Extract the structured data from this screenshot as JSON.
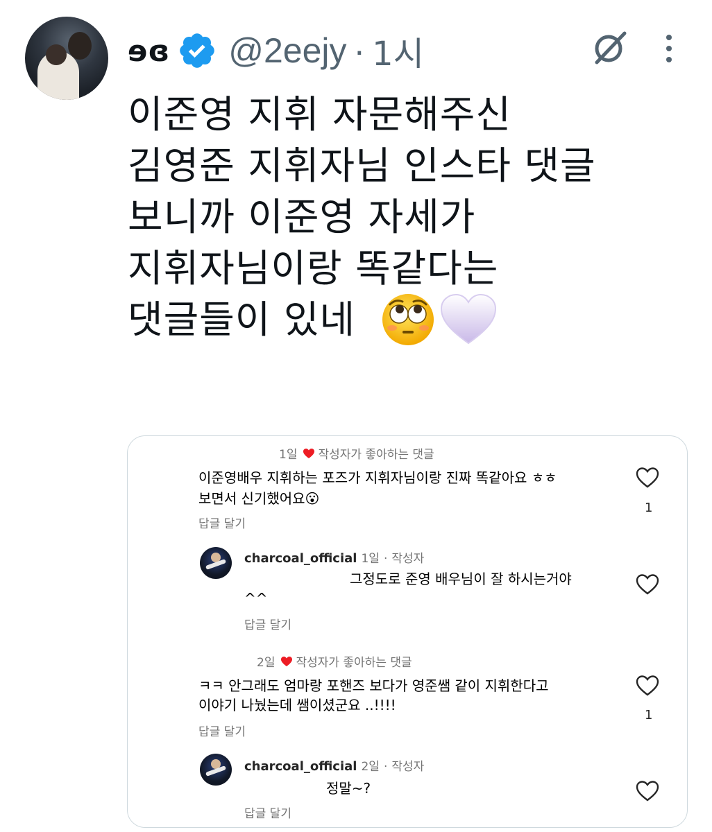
{
  "tweet": {
    "display_name": "ɘɞ",
    "handle": "@2eejy",
    "separator": "·",
    "time": "1시",
    "lines": [
      "이준영 지휘 자문해주신",
      "김영준 지휘자님 인스타 댓글",
      "보니까 이준영 자세가",
      "지휘자님이랑 똑같다는",
      "댓글들이 있네"
    ]
  },
  "embedded": {
    "comments": [
      {
        "date": "1일",
        "liked_label": "작성자가 좋아하는 댓글",
        "line1": "이준영배우 지휘하는 포즈가 지휘자님이랑 진짜 똑같아요 ㅎㅎ",
        "line2": "보면서 신기했어요😮",
        "reply_label": "답글 달기",
        "like_count": "1"
      },
      {
        "author": "charcoal_official",
        "date": "1일",
        "role": "작성자",
        "line1": "그정도로 준영 배우님이 잘 하시는거야",
        "line2": "^^",
        "reply_label": "답글 달기"
      },
      {
        "date": "2일",
        "liked_label": "작성자가 좋아하는 댓글",
        "line1": "ㅋㅋ 안그래도 엄마랑 포핸즈 보다가  영준쌤 같이 지휘한다고",
        "line2": "이야기 나눴는데 쌤이셨군요 ..!!!!",
        "reply_label": "답글 달기",
        "like_count": "1"
      },
      {
        "author": "charcoal_official",
        "date": "2일",
        "role": "작성자",
        "line1": "정말~?",
        "reply_label": "답글 달기"
      }
    ]
  },
  "icons": {
    "verified": "verified-badge-icon",
    "grok": "grok-icon",
    "more": "more-vertical-icon",
    "heart": "heart-outline-icon",
    "liked": "red-heart-icon"
  },
  "colors": {
    "verified_blue": "#1d9bf0",
    "secondary_text": "#536471",
    "liked_heart": "#ed1c24"
  }
}
